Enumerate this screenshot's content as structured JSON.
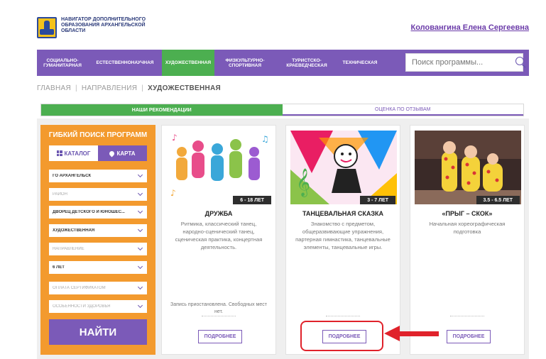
{
  "header": {
    "logo_lines": [
      "НАВИГАТОР ДОПОЛНИТЕЛЬНОГО",
      "ОБРАЗОВАНИЯ АРХАНГЕЛЬСКОЙ",
      "ОБЛАСТИ"
    ],
    "user_name": "Коловангина Елена Сергеевна"
  },
  "nav": {
    "tabs": [
      {
        "label": "СОЦИАЛЬНО-ГУМАНИТАРНАЯ",
        "active": false
      },
      {
        "label": "ЕСТЕСТВЕННОНАУЧНАЯ",
        "active": false
      },
      {
        "label": "ХУДОЖЕСТВЕННАЯ",
        "active": true
      },
      {
        "label": "ФИЗКУЛЬТУРНО-СПОРТИВНАЯ",
        "active": false
      },
      {
        "label": "ТУРИСТСКО-КРАЕВЕДЧЕСКАЯ",
        "active": false
      },
      {
        "label": "ТЕХНИЧЕСКАЯ",
        "active": false
      }
    ],
    "search_placeholder": "Поиск программы..."
  },
  "breadcrumb": {
    "items": [
      "ГЛАВНАЯ",
      "НАПРАВЛЕНИЯ",
      "ХУДОЖЕСТВЕННАЯ"
    ]
  },
  "recommendations": {
    "active_tab": "НАШИ РЕКОМЕНДАЦИИ",
    "other_tab": "ОЦЕНКА ПО ОТЗЫВАМ"
  },
  "filter": {
    "title": "ГИБКИЙ ПОИСК ПРОГРАММ",
    "catalog_label": "КАТАЛОГ",
    "map_label": "КАРТА",
    "selects": [
      {
        "text": "ГО АРХАНГЕЛЬСК",
        "placeholder": false
      },
      {
        "text": "РАЙОН",
        "placeholder": true
      },
      {
        "text": "ДВОРЕЦ ДЕТСКОГО И ЮНОШЕС...",
        "placeholder": false
      },
      {
        "text": "ХУДОЖЕСТВЕННАЯ",
        "placeholder": false
      },
      {
        "text": "НАПРАВЛЕНИЕ",
        "placeholder": true
      },
      {
        "text": "6 ЛЕТ",
        "placeholder": false
      },
      {
        "text": "ОПЛАТА СЕРТИФИКАТОМ",
        "placeholder": true
      },
      {
        "text": "ОСОБЕННОСТИ ЗДОРОВЬЯ",
        "placeholder": true
      }
    ],
    "find_label": "НАЙТИ"
  },
  "cards": [
    {
      "age": "6 - 18 ЛЕТ",
      "title": "ДРУЖБА",
      "description": "Ритмика, классический танец, народно-сценический танец, сценическая практика, концертная деятельность.",
      "note": "Запись приостановлена. Свободных мест нет.",
      "button": "ПОДРОБНЕЕ"
    },
    {
      "age": "3 - 7 ЛЕТ",
      "title": "ТАНЦЕВАЛЬНАЯ СКАЗКА",
      "description": "Знакомство с предметом, общеразвивающие упражнения, партерная гимнастика, танцевальные элементы, танцевальные игры.",
      "note": "",
      "button": "ПОДРОБНЕЕ"
    },
    {
      "age": "3.5 - 6.5 ЛЕТ",
      "title": "«ПРЫГ – СКОК»",
      "description": "Начальная хореографическая подготовка",
      "note": "",
      "button": "ПОДРОБНЕЕ"
    }
  ],
  "colors": {
    "purple": "#7b5ab8",
    "green": "#4caf50",
    "orange": "#f39a2e",
    "highlight_red": "#e0222b"
  }
}
